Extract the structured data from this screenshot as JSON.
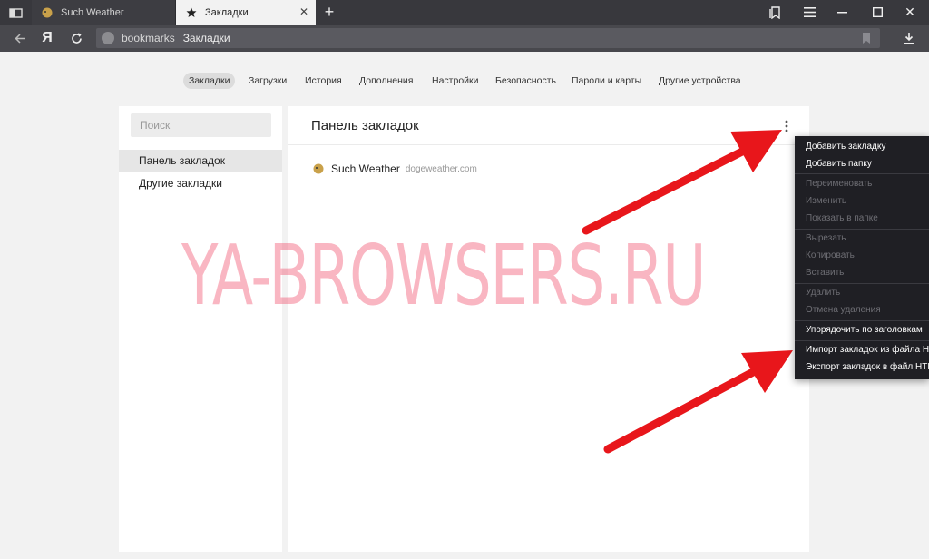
{
  "tabs": {
    "inactive_label": "Such Weather",
    "active_label": "Закладки"
  },
  "toolbar": {
    "url_prefix": "bookmarks",
    "url_title": "Закладки"
  },
  "nav": {
    "items": [
      "Закладки",
      "Загрузки",
      "История",
      "Дополнения",
      "Настройки",
      "Безопасность",
      "Пароли и карты",
      "Другие устройства"
    ]
  },
  "sidebar": {
    "search_placeholder": "Поиск",
    "items": [
      "Панель закладок",
      "Другие закладки"
    ]
  },
  "main": {
    "title": "Панель закладок",
    "bookmark": {
      "name": "Such Weather",
      "domain": "dogeweather.com"
    }
  },
  "watermark": "YA-BROWSERS.RU",
  "context_menu": {
    "items": [
      {
        "label": "Добавить закладку",
        "enabled": true
      },
      {
        "label": "Добавить папку",
        "enabled": true
      },
      {
        "label": "Переименовать",
        "enabled": false
      },
      {
        "label": "Изменить",
        "enabled": false
      },
      {
        "label": "Показать в папке",
        "enabled": false
      },
      {
        "label": "Вырезать",
        "enabled": false
      },
      {
        "label": "Копировать",
        "enabled": false
      },
      {
        "label": "Вставить",
        "enabled": false
      },
      {
        "label": "Удалить",
        "enabled": false
      },
      {
        "label": "Отмена удаления",
        "enabled": false
      },
      {
        "label": "Упорядочить по заголовкам",
        "enabled": true
      },
      {
        "label": "Импорт закладок из файла HTML",
        "enabled": true
      },
      {
        "label": "Экспорт закладок в файл HTML",
        "enabled": true
      }
    ]
  },
  "colors": {
    "titlebar": "#38383d",
    "toolbar": "#48484d",
    "menu_bg": "#1f1f24",
    "annotation_arrow": "#e8161b"
  }
}
